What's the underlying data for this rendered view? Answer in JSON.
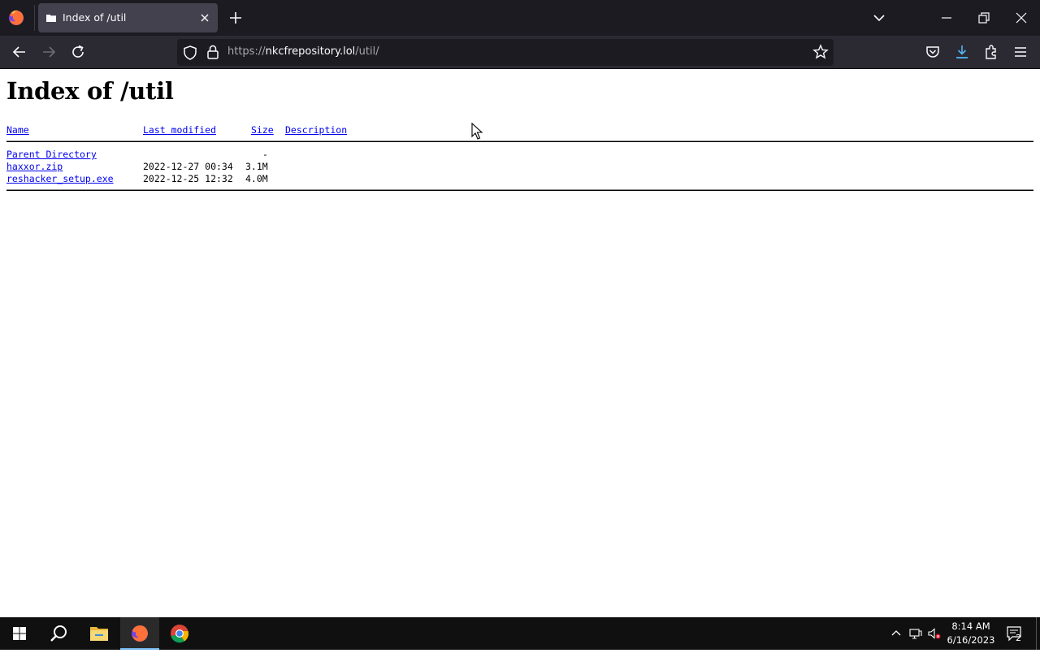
{
  "browser": {
    "tab": {
      "title": "Index of /util"
    },
    "url": {
      "scheme": "https://",
      "host": "nkcfrepository.lol",
      "path": "/util/"
    }
  },
  "page": {
    "title": "Index of /util",
    "columns": {
      "name": "Name",
      "last_modified": "Last modified",
      "size": "Size",
      "description": "Description"
    },
    "rows": [
      {
        "name": "Parent Directory",
        "last_modified": "",
        "size": "-",
        "description": ""
      },
      {
        "name": "haxxor.zip",
        "last_modified": "2022-12-27 00:34",
        "size": "3.1M",
        "description": ""
      },
      {
        "name": "reshacker_setup.exe",
        "last_modified": "2022-12-25 12:32",
        "size": "4.0M",
        "description": ""
      }
    ]
  },
  "taskbar": {
    "time": "8:14 AM",
    "date": "6/16/2023",
    "notification_count": "2"
  },
  "colors": {
    "tabbar_bg": "#1c1b22",
    "toolbar_bg": "#2b2a33",
    "link": "#0000ee",
    "taskbar_bg": "#101010",
    "download_accent": "#54b3f2"
  }
}
